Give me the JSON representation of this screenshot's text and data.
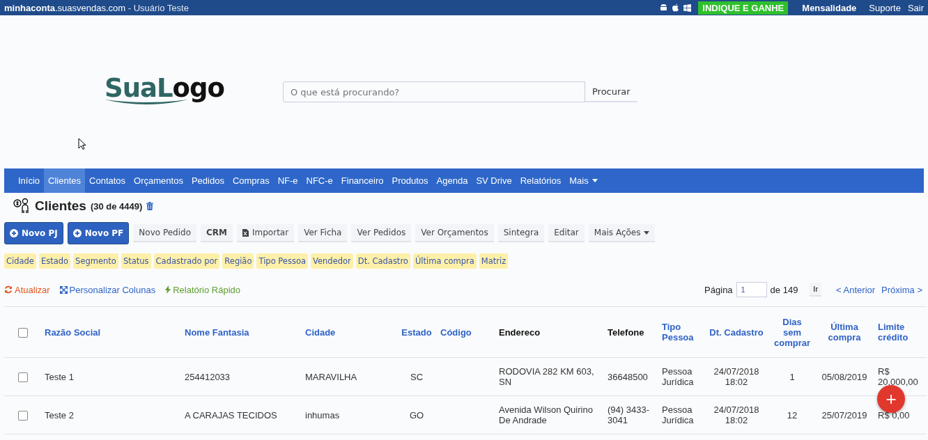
{
  "top_bar": {
    "domain_bold": "minhaconta",
    "domain_rest": ".suasvendas.com",
    "user": " - Usuário Teste",
    "promo": "INDIQUE E GANHE",
    "links": [
      "Mensalidade",
      "Suporte",
      "Sair"
    ]
  },
  "logo": [
    {
      "text": "Sua",
      "accent": true
    },
    {
      "text": "L",
      "accent": true
    },
    {
      "text": "ogo",
      "accent": false
    }
  ],
  "search": {
    "placeholder": "O que está procurando?",
    "button": "Procurar"
  },
  "nav": [
    {
      "label": "Início",
      "selected": false
    },
    {
      "label": "Clientes",
      "selected": true
    },
    {
      "label": "Contatos",
      "selected": false
    },
    {
      "label": "Orçamentos",
      "selected": false
    },
    {
      "label": "Pedidos",
      "selected": false
    },
    {
      "label": "Compras",
      "selected": false
    },
    {
      "label": "NF-e",
      "selected": false
    },
    {
      "label": "NFC-e",
      "selected": false
    },
    {
      "label": "Financeiro",
      "selected": false
    },
    {
      "label": "Produtos",
      "selected": false
    },
    {
      "label": "Agenda",
      "selected": false
    },
    {
      "label": "SV Drive",
      "selected": false
    },
    {
      "label": "Relatórios",
      "selected": false
    },
    {
      "label": "Mais",
      "selected": false,
      "dropdown": true
    }
  ],
  "page": {
    "title": "Clientes",
    "count": "(30 de 4449)"
  },
  "actions": [
    {
      "label": "Novo PJ",
      "kind": "primary"
    },
    {
      "label": "Novo PF",
      "kind": "primary"
    },
    {
      "label": "Novo Pedido",
      "kind": "plain"
    },
    {
      "label": "CRM",
      "kind": "bold"
    },
    {
      "label": "Importar",
      "kind": "excel"
    },
    {
      "label": "Ver Ficha",
      "kind": "plain"
    },
    {
      "label": "Ver Pedidos",
      "kind": "plain"
    },
    {
      "label": "Ver Orçamentos",
      "kind": "plain"
    },
    {
      "label": "Sintegra",
      "kind": "plain"
    },
    {
      "label": "Editar",
      "kind": "plain"
    },
    {
      "label": "Mais Ações",
      "kind": "dropdown"
    }
  ],
  "filters": [
    "Cidade",
    "Estado",
    "Segmento",
    "Status",
    "Cadastrado por",
    "Região",
    "Tipo Pessoa",
    "Vendedor",
    "Dt. Cadastro",
    "Última compra",
    "Matriz"
  ],
  "tools": [
    {
      "label": "Atualizar",
      "kind": "refresh"
    },
    {
      "label": "Personalizar Colunas",
      "kind": "columns"
    },
    {
      "label": "Relatório Rápido",
      "kind": "bolt"
    }
  ],
  "pager": {
    "label": "Página",
    "value": "1",
    "total": "de 149",
    "go": "Ir",
    "prev": "< Anterior",
    "next": "Próxima >"
  },
  "table": {
    "select_all_checked": false,
    "columns": [
      {
        "label": "Razão Social",
        "sortable": true
      },
      {
        "label": "Nome Fantasia",
        "sortable": true
      },
      {
        "label": "Cidade",
        "sortable": true
      },
      {
        "label": "Estado",
        "sortable": true
      },
      {
        "label": "Código",
        "sortable": true
      },
      {
        "label": "Endereco",
        "sortable": false
      },
      {
        "label": "Telefone",
        "sortable": false
      },
      {
        "label": "Tipo Pessoa",
        "sortable": true
      },
      {
        "label": "Dt. Cadastro",
        "sortable": true
      },
      {
        "label": "Dias sem comprar",
        "sortable": true
      },
      {
        "label": "Última compra",
        "sortable": true
      },
      {
        "label": "Limite crédito",
        "sortable": true
      }
    ],
    "rows": [
      {
        "checked": false,
        "cells": [
          "Teste 1",
          "254412033",
          "MARAVILHA",
          "SC",
          "",
          "RODOVIA 282 KM 603, SN",
          "36648500",
          "Pessoa Jurídica",
          "24/07/2018 18:02",
          "1",
          "05/08/2019",
          "R$ 20.000,00"
        ]
      },
      {
        "checked": false,
        "cells": [
          "Teste 2",
          "A CARAJAS TECIDOS",
          "inhumas",
          "GO",
          "",
          "Avenida Wilson Quirino De Andrade",
          "(94) 3433-3041",
          "Pessoa Jurídica",
          "24/07/2018 18:02",
          "12",
          "25/07/2019",
          "R$ 0,00"
        ]
      }
    ]
  },
  "fab": "+"
}
